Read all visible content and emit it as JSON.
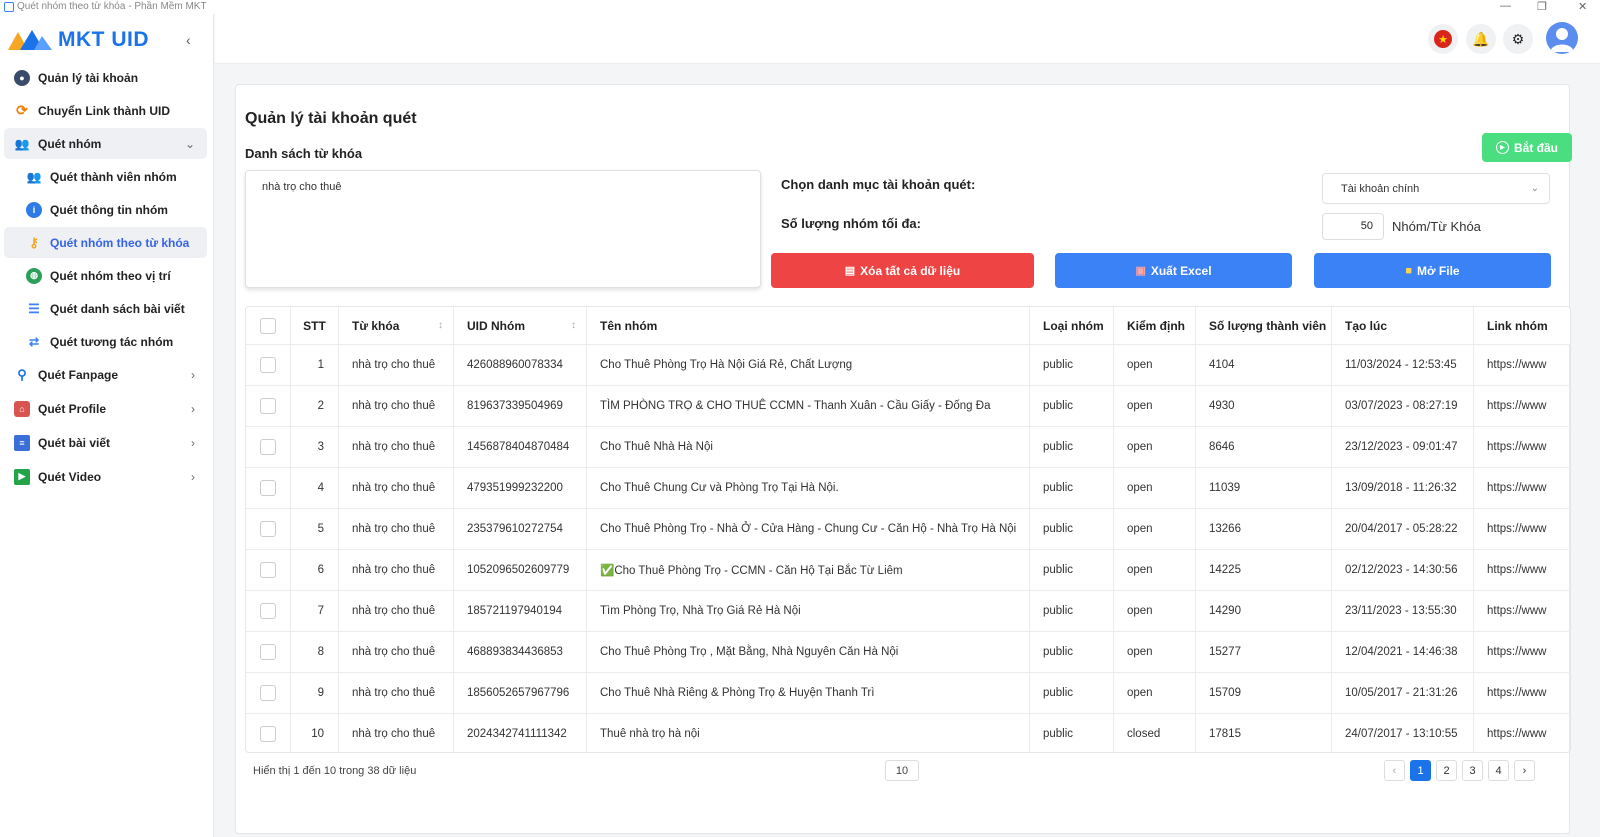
{
  "window": {
    "title": "Quét nhóm theo từ khóa - Phần Mềm MKT"
  },
  "brand": {
    "name": "MKT UID"
  },
  "sidebar": {
    "items": [
      {
        "label": "Quản lý tài khoản"
      },
      {
        "label": "Chuyển Link thành UID"
      },
      {
        "label": "Quét nhóm"
      },
      {
        "label": "Quét thành viên nhóm"
      },
      {
        "label": "Quét thông tin nhóm"
      },
      {
        "label": "Quét nhóm theo từ khóa"
      },
      {
        "label": "Quét nhóm theo vị trí"
      },
      {
        "label": "Quét danh sách bài viết"
      },
      {
        "label": "Quét tương tác nhóm"
      },
      {
        "label": "Quét Fanpage"
      },
      {
        "label": "Quét Profile"
      },
      {
        "label": "Quét bài viết"
      },
      {
        "label": "Quét Video"
      }
    ]
  },
  "page": {
    "title": "Quản lý tài khoản quét",
    "keywords_label": "Danh sách từ khóa",
    "keywords_value": "nhà trọ cho thuê",
    "start_label": "Bắt đầu",
    "account_category_label": "Chọn danh mục tài khoản quét:",
    "account_category_value": "Tài khoản chính",
    "max_groups_label": "Số lượng nhóm tối đa:",
    "max_groups_value": "50",
    "max_groups_unit": "Nhóm/Từ Khóa",
    "delete_all_label": "Xóa tất cả dữ liệu",
    "export_excel_label": "Xuất Excel",
    "open_file_label": "Mở File"
  },
  "table": {
    "headers": [
      "STT",
      "Từ khóa",
      "UID Nhóm",
      "Tên nhóm",
      "Loại nhóm",
      "Kiểm định",
      "Số lượng thành viên",
      "Tạo lúc",
      "Link nhóm"
    ],
    "rows": [
      {
        "stt": "1",
        "kw": "nhà trọ cho thuê",
        "uid": "426088960078334",
        "name": "Cho Thuê Phòng Trọ Hà Nội Giá Rẻ, Chất Lượng",
        "type": "public",
        "check": "open",
        "members": "4104",
        "created": "11/03/2024 - 12:53:45",
        "link": "https://www"
      },
      {
        "stt": "2",
        "kw": "nhà trọ cho thuê",
        "uid": "819637339504969",
        "name": "TÌM PHÒNG TRỌ & CHO THUÊ CCMN - Thanh Xuân - Cầu Giấy - Đống Đa",
        "type": "public",
        "check": "open",
        "members": "4930",
        "created": "03/07/2023 - 08:27:19",
        "link": "https://www"
      },
      {
        "stt": "3",
        "kw": "nhà trọ cho thuê",
        "uid": "1456878404870484",
        "name": "Cho Thuê Nhà Hà Nội",
        "type": "public",
        "check": "open",
        "members": "8646",
        "created": "23/12/2023 - 09:01:47",
        "link": "https://www"
      },
      {
        "stt": "4",
        "kw": "nhà trọ cho thuê",
        "uid": "479351999232200",
        "name": "Cho Thuê Chung Cư và Phòng Trọ Tại Hà Nội.",
        "type": "public",
        "check": "open",
        "members": "11039",
        "created": "13/09/2018 - 11:26:32",
        "link": "https://www"
      },
      {
        "stt": "5",
        "kw": "nhà trọ cho thuê",
        "uid": "235379610272754",
        "name": "Cho Thuê Phòng Trọ - Nhà Ở - Cửa Hàng - Chung Cư - Căn Hộ - Nhà Trọ Hà Nội",
        "type": "public",
        "check": "open",
        "members": "13266",
        "created": "20/04/2017 - 05:28:22",
        "link": "https://www"
      },
      {
        "stt": "6",
        "kw": "nhà trọ cho thuê",
        "uid": "1052096502609779",
        "name": "✅Cho Thuê Phòng Trọ - CCMN - Căn Hộ Tại Bắc Từ Liêm",
        "type": "public",
        "check": "open",
        "members": "14225",
        "created": "02/12/2023 - 14:30:56",
        "link": "https://www"
      },
      {
        "stt": "7",
        "kw": "nhà trọ cho thuê",
        "uid": "185721197940194",
        "name": "Tìm Phòng Trọ, Nhà Trọ Giá Rẻ Hà Nội",
        "type": "public",
        "check": "open",
        "members": "14290",
        "created": "23/11/2023 - 13:55:30",
        "link": "https://www"
      },
      {
        "stt": "8",
        "kw": "nhà trọ cho thuê",
        "uid": "468893834436853",
        "name": "Cho Thuê Phòng Trọ , Mặt Bằng, Nhà Nguyên Căn Hà Nội",
        "type": "public",
        "check": "open",
        "members": "15277",
        "created": "12/04/2021 - 14:46:38",
        "link": "https://www"
      },
      {
        "stt": "9",
        "kw": "nhà trọ cho thuê",
        "uid": "1856052657967796",
        "name": "Cho Thuê Nhà Riêng & Phòng Trọ & Huyện Thanh Trì",
        "type": "public",
        "check": "open",
        "members": "15709",
        "created": "10/05/2017 - 21:31:26",
        "link": "https://www"
      },
      {
        "stt": "10",
        "kw": "nhà trọ cho thuê",
        "uid": "2024342741111342",
        "name": "Thuê nhà trọ hà nội",
        "type": "public",
        "check": "closed",
        "members": "17815",
        "created": "24/07/2017 - 13:10:55",
        "link": "https://www"
      }
    ]
  },
  "footer": {
    "summary": "Hiển thị 1 đến 10 trong 38 dữ liệu",
    "page_size": "10",
    "pages": [
      "1",
      "2",
      "3",
      "4"
    ],
    "prev": "‹",
    "next": "›"
  }
}
